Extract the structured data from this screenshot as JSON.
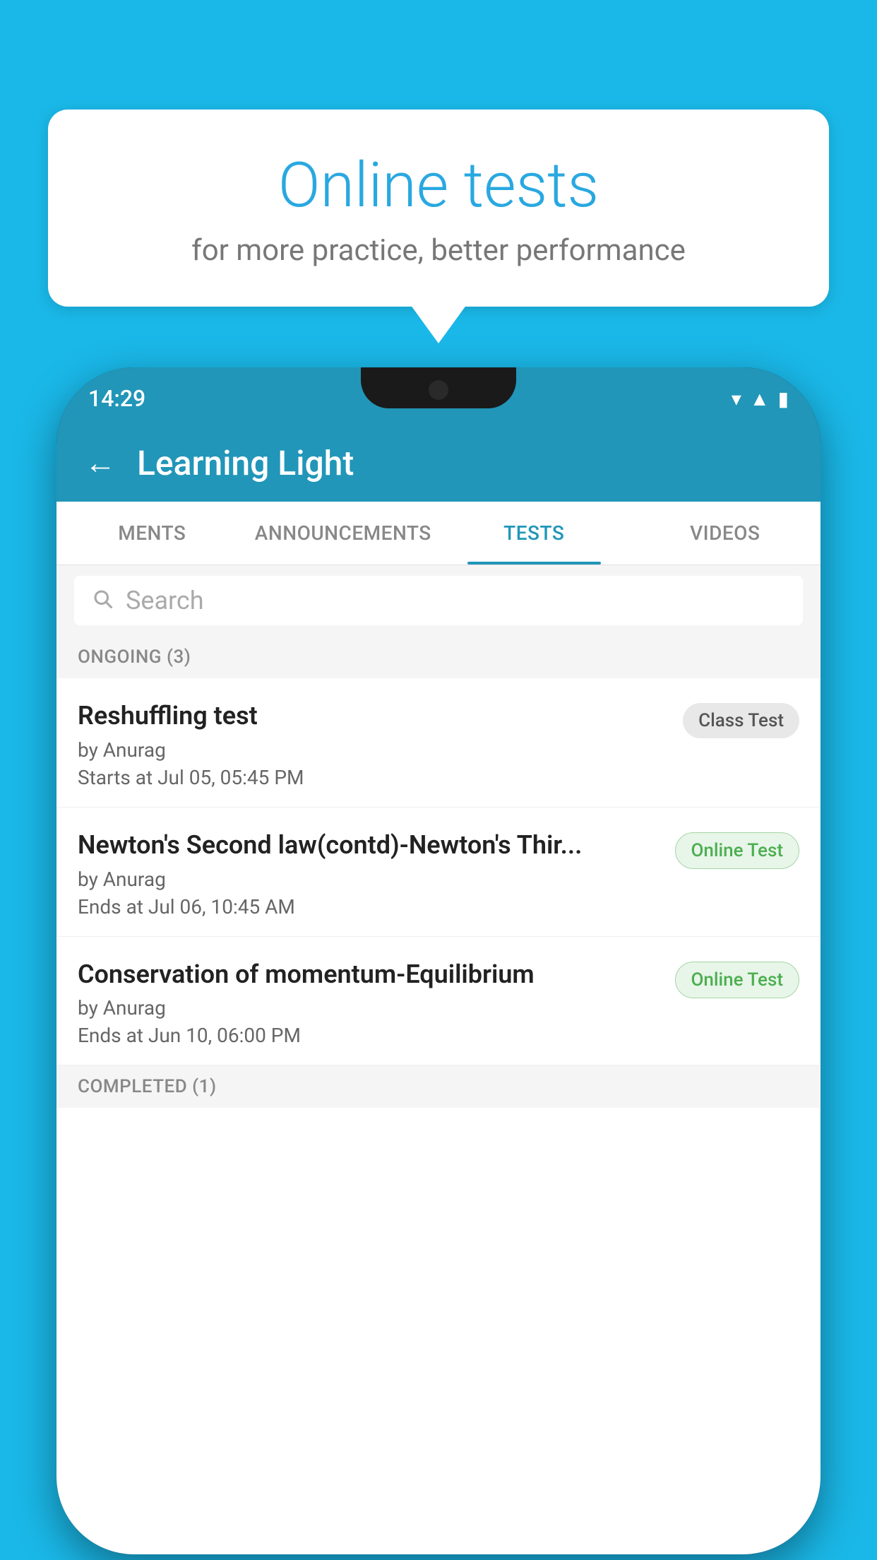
{
  "background_color": "#1ab8e8",
  "bubble": {
    "title": "Online tests",
    "subtitle": "for more practice, better performance"
  },
  "status_bar": {
    "time": "14:29",
    "icons": [
      "wifi",
      "signal",
      "battery"
    ]
  },
  "header": {
    "title": "Learning Light",
    "back_label": "←"
  },
  "tabs": [
    {
      "label": "MENTS",
      "active": false
    },
    {
      "label": "ANNOUNCEMENTS",
      "active": false
    },
    {
      "label": "TESTS",
      "active": true
    },
    {
      "label": "VIDEOS",
      "active": false
    }
  ],
  "search": {
    "placeholder": "Search"
  },
  "section_ongoing": {
    "label": "ONGOING (3)"
  },
  "tests": [
    {
      "name": "Reshuffling test",
      "author": "by Anurag",
      "time_label": "Starts at  Jul 05, 05:45 PM",
      "badge": "Class Test",
      "badge_type": "class"
    },
    {
      "name": "Newton's Second law(contd)-Newton's Thir...",
      "author": "by Anurag",
      "time_label": "Ends at  Jul 06, 10:45 AM",
      "badge": "Online Test",
      "badge_type": "online"
    },
    {
      "name": "Conservation of momentum-Equilibrium",
      "author": "by Anurag",
      "time_label": "Ends at  Jun 10, 06:00 PM",
      "badge": "Online Test",
      "badge_type": "online"
    }
  ],
  "section_completed": {
    "label": "COMPLETED (1)"
  }
}
